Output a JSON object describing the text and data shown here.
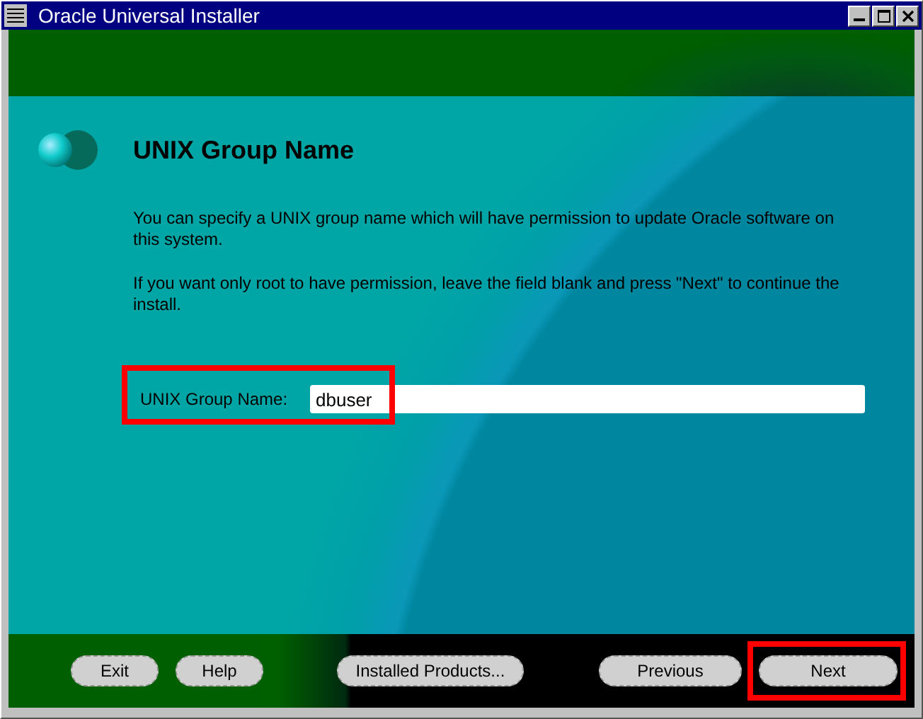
{
  "window": {
    "title": "Oracle Universal Installer"
  },
  "page": {
    "title": "UNIX Group Name",
    "paragraphs": [
      "You can specify a UNIX group name which will have permission to update Oracle software on this system.",
      "If you want only root to have permission, leave the field blank and press \"Next\" to continue the install."
    ],
    "field": {
      "label": "UNIX Group Name:",
      "value": "dbuser",
      "highlighted": true
    }
  },
  "buttons": [
    {
      "label": "Exit",
      "highlighted": false
    },
    {
      "label": "Help",
      "highlighted": false
    },
    {
      "label": "Installed Products...",
      "highlighted": false
    },
    {
      "label": "Previous",
      "highlighted": false
    },
    {
      "label": "Next",
      "highlighted": true
    }
  ]
}
